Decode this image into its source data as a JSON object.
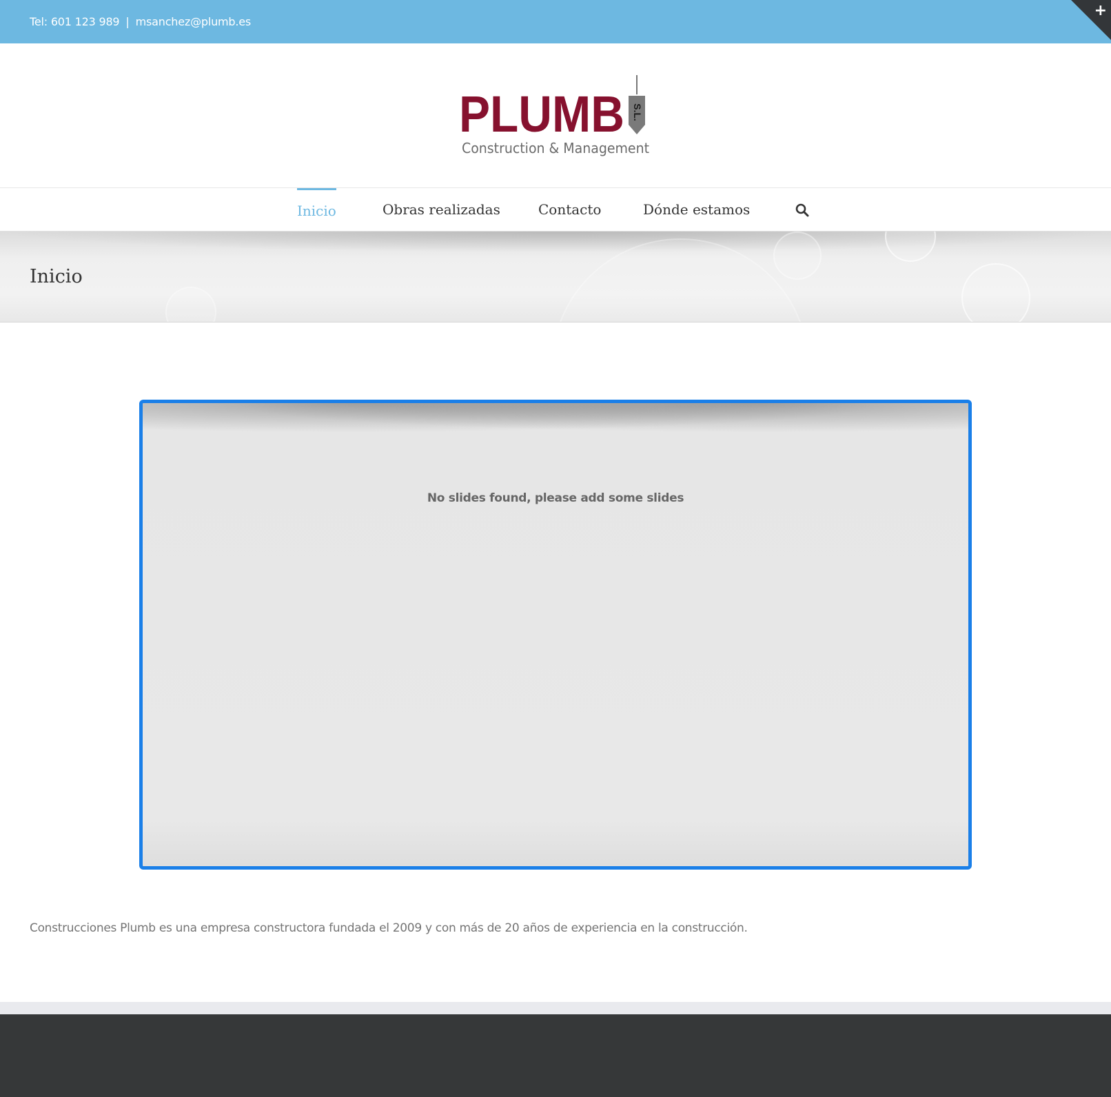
{
  "topbar": {
    "phone": "Tel: 601 123 989",
    "separator": "|",
    "email": "msanchez@plumb.es",
    "corner_icon": "plus-icon",
    "bg_color": "#6db8e1"
  },
  "logo": {
    "wordmark": "PLUMB",
    "badge": "S.L.",
    "tagline": "Construction & Management",
    "brand_color": "#86112e"
  },
  "nav": {
    "items": [
      {
        "label": "Inicio",
        "active": true
      },
      {
        "label": "Obras realizadas",
        "active": false
      },
      {
        "label": "Contacto",
        "active": false
      },
      {
        "label": "Dónde estamos",
        "active": false
      }
    ],
    "search_icon": "search-icon",
    "accent_color": "#6db8e1"
  },
  "page": {
    "title": "Inicio"
  },
  "slider": {
    "message": "No slides found, please add some slides",
    "border_color": "#1a7fe8"
  },
  "content": {
    "intro": "Construcciones Plumb es una empresa constructora fundada el 2009 y con más de 20 años de experiencia en la construcción."
  },
  "footer": {
    "bg_color": "#363839"
  }
}
